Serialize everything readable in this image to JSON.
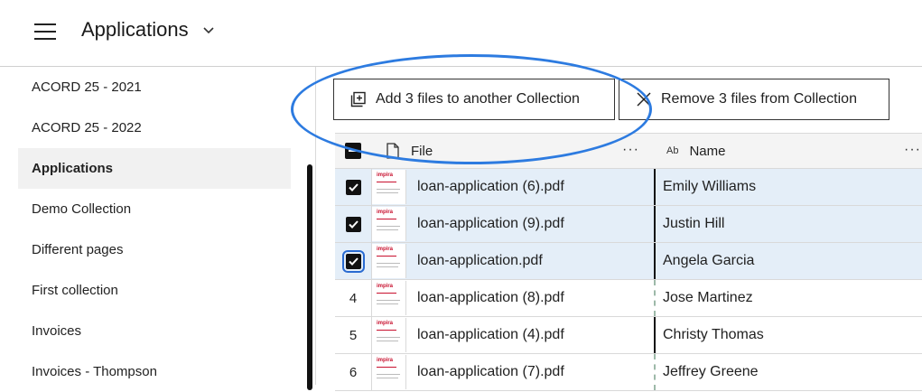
{
  "header": {
    "title": "Applications"
  },
  "sidebar": {
    "items": [
      {
        "label": "ACORD 25 - 2021",
        "active": false
      },
      {
        "label": "ACORD 25 - 2022",
        "active": false
      },
      {
        "label": "Applications",
        "active": true
      },
      {
        "label": "Demo Collection",
        "active": false
      },
      {
        "label": "Different pages",
        "active": false
      },
      {
        "label": "First collection",
        "active": false
      },
      {
        "label": "Invoices",
        "active": false
      },
      {
        "label": "Invoices - Thompson",
        "active": false
      }
    ]
  },
  "toolbar": {
    "add_label": "Add 3 files to another Collection",
    "remove_label": "Remove 3 files from Collection"
  },
  "table": {
    "columns": {
      "file": "File",
      "name_type": "Ab",
      "name": "Name",
      "menu": "···"
    },
    "rows": [
      {
        "selected": true,
        "num": "",
        "file": "loan-application (6).pdf",
        "name": "Emily Williams"
      },
      {
        "selected": true,
        "num": "",
        "file": "loan-application (9).pdf",
        "name": "Justin Hill"
      },
      {
        "selected": true,
        "num": "",
        "file": "loan-application.pdf",
        "name": "Angela Garcia"
      },
      {
        "selected": false,
        "num": "4",
        "file": "loan-application (8).pdf",
        "name": "Jose Martinez"
      },
      {
        "selected": false,
        "num": "5",
        "file": "loan-application (4).pdf",
        "name": "Christy Thomas"
      },
      {
        "selected": false,
        "num": "6",
        "file": "loan-application (7).pdf",
        "name": "Jeffrey Greene"
      }
    ],
    "thumb_logo": "impira"
  },
  "colors": {
    "accent": "#2d7be0",
    "selected_row": "#e4eef8",
    "brand_red": "#c8102e"
  },
  "icons": {
    "menu": "hamburger-icon",
    "dropdown": "chevron-down-icon",
    "add": "add-to-collection-icon",
    "remove": "close-icon",
    "file": "file-icon"
  }
}
